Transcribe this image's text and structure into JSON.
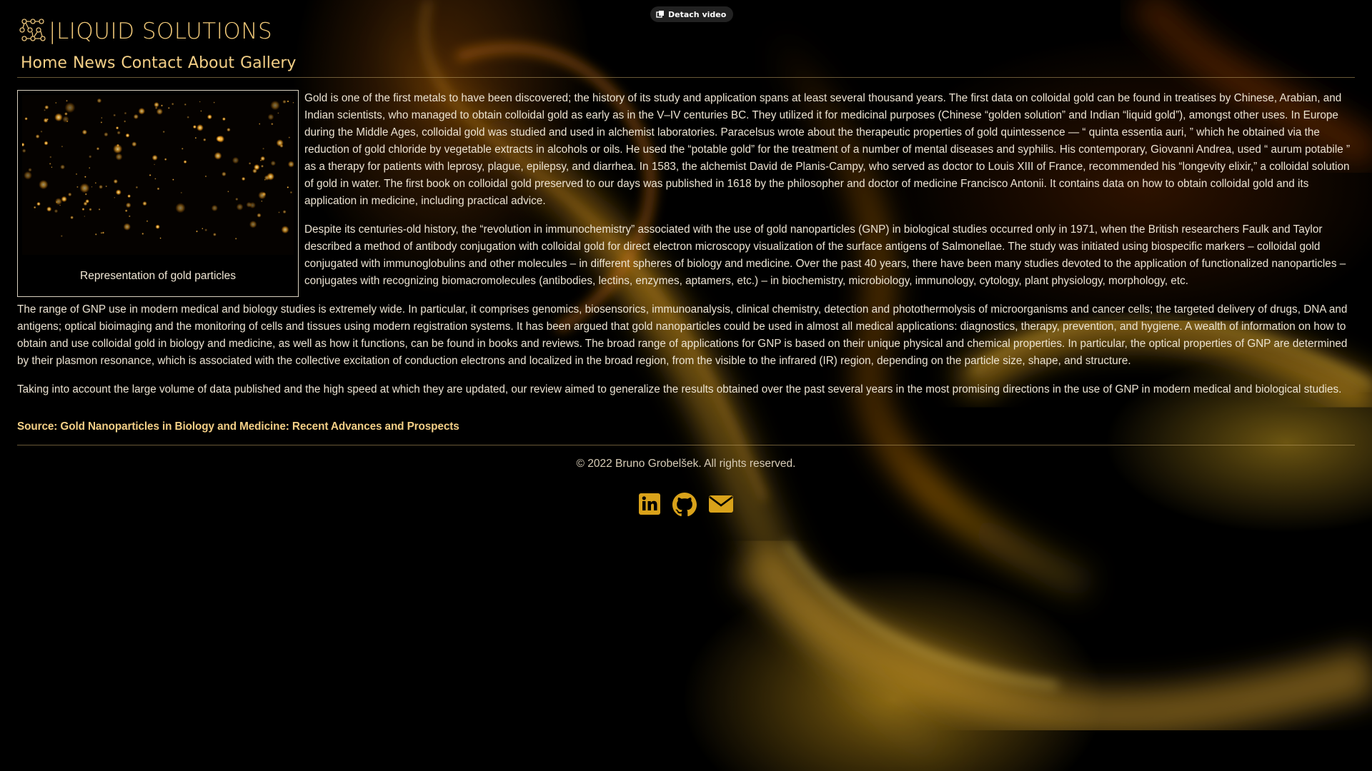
{
  "detach": {
    "label": "Detach video"
  },
  "brand": {
    "title": "|LIQUID SOLUTIONS"
  },
  "nav": {
    "items": [
      {
        "label": "Home"
      },
      {
        "label": "News"
      },
      {
        "label": "Contact"
      },
      {
        "label": "About"
      },
      {
        "label": "Gallery"
      }
    ]
  },
  "figure": {
    "caption": "Representation of gold particles"
  },
  "article": {
    "paragraphs": [
      "Gold is one of the first metals to have been discovered; the history of its study and application spans at least several thousand years. The first data on colloidal gold can be found in treatises by Chinese, Arabian, and Indian scientists, who managed to obtain colloidal gold as early as in the V–IV centuries BC. They utilized it for medicinal purposes (Chinese “golden solution” and Indian “liquid gold”), amongst other uses. In Europe during the Middle Ages, colloidal gold was studied and used in alchemist laboratories. Paracelsus wrote about the therapeutic properties of gold quintessence — “ quinta essentia auri, ” which he obtained via the reduction of gold chloride by vegetable extracts in alcohols or oils. He used the “potable gold” for the treatment of a number of mental diseases and syphilis. His contemporary, Giovanni Andrea, used “ aurum potabile ” as a therapy for patients with leprosy, plague, epilepsy, and diarrhea. In 1583, the alchemist David de Planis-Campy, who served as doctor to Louis XIII of France, recommended his “longevity elixir,” a colloidal solution of gold in water. The first book on colloidal gold preserved to our days was published in 1618 by the philosopher and doctor of medicine Francisco Antonii. It contains data on how to obtain colloidal gold and its application in medicine, including practical advice.",
      "Despite its centuries-old history, the “revolution in immunochemistry” associated with the use of gold nanoparticles (GNP) in biological studies occurred only in 1971, when the British researchers Faulk and Taylor described a method of antibody conjugation with colloidal gold for direct electron microscopy visualization of the surface antigens of Salmonellae. The study was initiated using biospecific markers – colloidal gold conjugated with immunoglobulins and other molecules – in different spheres of biology and medicine. Over the past 40 years, there have been many studies devoted to the application of functionalized nanoparticles – conjugates with recognizing biomacromolecules (antibodies, lectins, enzymes, aptamers, etc.) – in biochemistry, microbiology, immunology, cytology, plant physiology, morphology, etc.",
      "The range of GNP use in modern medical and biology studies is extremely wide. In particular, it comprises genomics, biosensorics, immunoanalysis, clinical chemistry, detection and photothermolysis of microorganisms and cancer cells; the targeted delivery of drugs, DNA and antigens; optical bioimaging and the monitoring of cells and tissues using modern registration systems. It has been argued that gold nanoparticles could be used in almost all medical applications: diagnostics, therapy, prevention, and hygiene. A wealth of information on how to obtain and use colloidal gold in biology and medicine, as well as how it functions, can be found in books and reviews. The broad range of applications for GNP is based on their unique physical and chemical properties. In particular, the optical properties of GNP are determined by their plasmon resonance, which is associated with the collective excitation of conduction electrons and localized in the broad region, from the visible to the infrared (IR) region, depending on the particle size, shape, and structure.",
      "Taking into account the large volume of data published and the high speed at which they are updated, our review aimed to generalize the results obtained over the past several years in the most promising directions in the use of GNP in modern medical and biological studies."
    ],
    "source": "Source: Gold Nanoparticles in Biology and Medicine: Recent Advances and Prospects"
  },
  "footer": {
    "copyright": "© 2022 Bruno Grobelšek. All rights reserved.",
    "social": [
      {
        "icon": "linkedin-icon"
      },
      {
        "icon": "github-icon"
      },
      {
        "icon": "envelope-icon"
      }
    ]
  },
  "colors": {
    "accent": "#f3cf86",
    "brand": "#f0c878",
    "background": "#000000",
    "social_icon": "#d9a21a"
  }
}
